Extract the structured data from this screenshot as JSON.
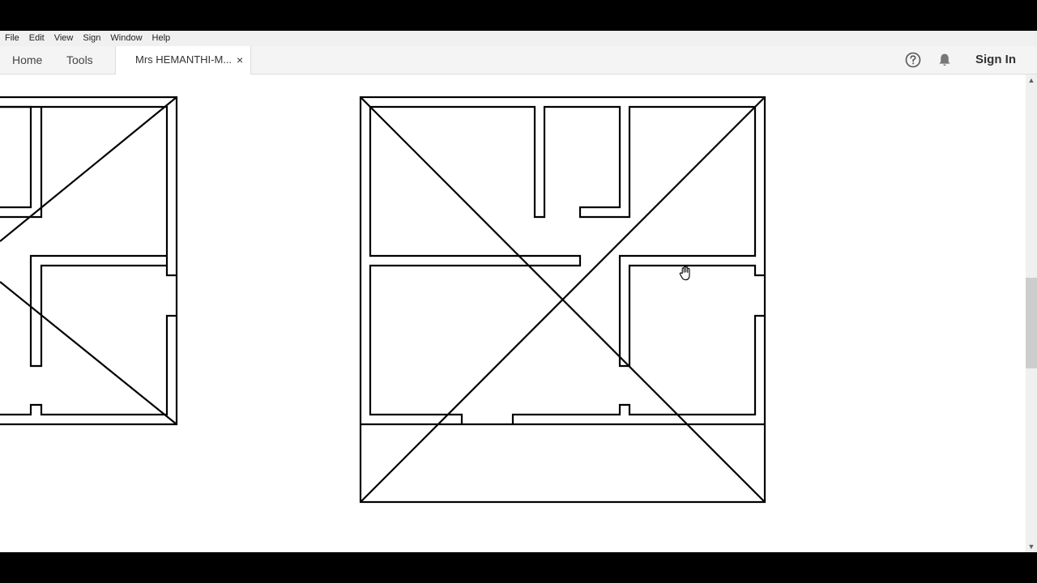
{
  "menu": {
    "items": [
      {
        "label": "File"
      },
      {
        "label": "Edit"
      },
      {
        "label": "View"
      },
      {
        "label": "Sign"
      },
      {
        "label": "Window"
      },
      {
        "label": "Help"
      }
    ]
  },
  "tabs": {
    "home_label": "Home",
    "tools_label": "Tools",
    "document_title": "Mrs HEMANTHI-M...",
    "close_symbol": "×"
  },
  "toolbar_right": {
    "help_icon": "help-circle-icon",
    "notification_icon": "bell-icon",
    "sign_in_label": "Sign In"
  },
  "document": {
    "content": "floor-plan-drawing",
    "cursor": "hand-icon"
  },
  "scrollbar": {
    "up_arrow": "▲",
    "down_arrow": "▼"
  }
}
